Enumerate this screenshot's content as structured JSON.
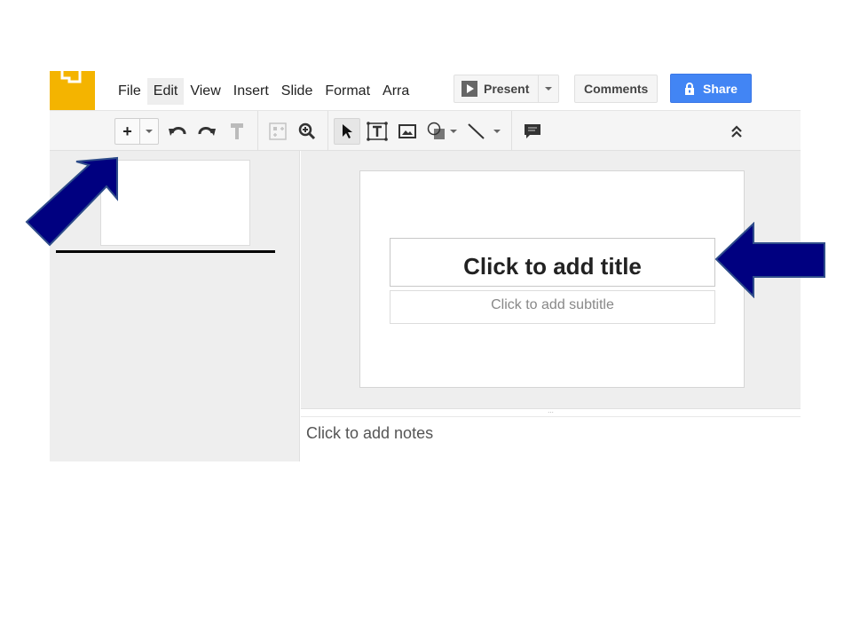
{
  "menubar": {
    "items": [
      {
        "label": "File",
        "active": false
      },
      {
        "label": "Edit",
        "active": true
      },
      {
        "label": "View",
        "active": false
      },
      {
        "label": "Insert",
        "active": false
      },
      {
        "label": "Slide",
        "active": false
      },
      {
        "label": "Format",
        "active": false
      },
      {
        "label": "Arra",
        "active": false
      }
    ],
    "present_label": "Present",
    "comments_label": "Comments",
    "share_label": "Share",
    "share_color": "#4285f4",
    "logo_color": "#f4b400"
  },
  "toolbar": {
    "tools": [
      {
        "name": "new-slide",
        "icon": "plus-icon"
      },
      {
        "name": "undo",
        "icon": "undo-icon"
      },
      {
        "name": "redo",
        "icon": "redo-icon"
      },
      {
        "name": "paint-format",
        "icon": "paint-roller-icon"
      },
      {
        "name": "fit",
        "icon": "fit-icon"
      },
      {
        "name": "zoom",
        "icon": "zoom-icon"
      },
      {
        "name": "select",
        "icon": "cursor-icon"
      },
      {
        "name": "text-box",
        "icon": "text-box-icon"
      },
      {
        "name": "image",
        "icon": "image-icon"
      },
      {
        "name": "shape",
        "icon": "shape-icon"
      },
      {
        "name": "line",
        "icon": "line-icon"
      },
      {
        "name": "comment",
        "icon": "comment-icon"
      },
      {
        "name": "collapse",
        "icon": "double-chevron-up-icon"
      }
    ]
  },
  "slide": {
    "title_placeholder": "Click to add title",
    "subtitle_placeholder": "Click to add subtitle"
  },
  "notes": {
    "placeholder": "Click to add notes",
    "handle": "..."
  },
  "annotations": {
    "arrow_color": "#000080"
  }
}
